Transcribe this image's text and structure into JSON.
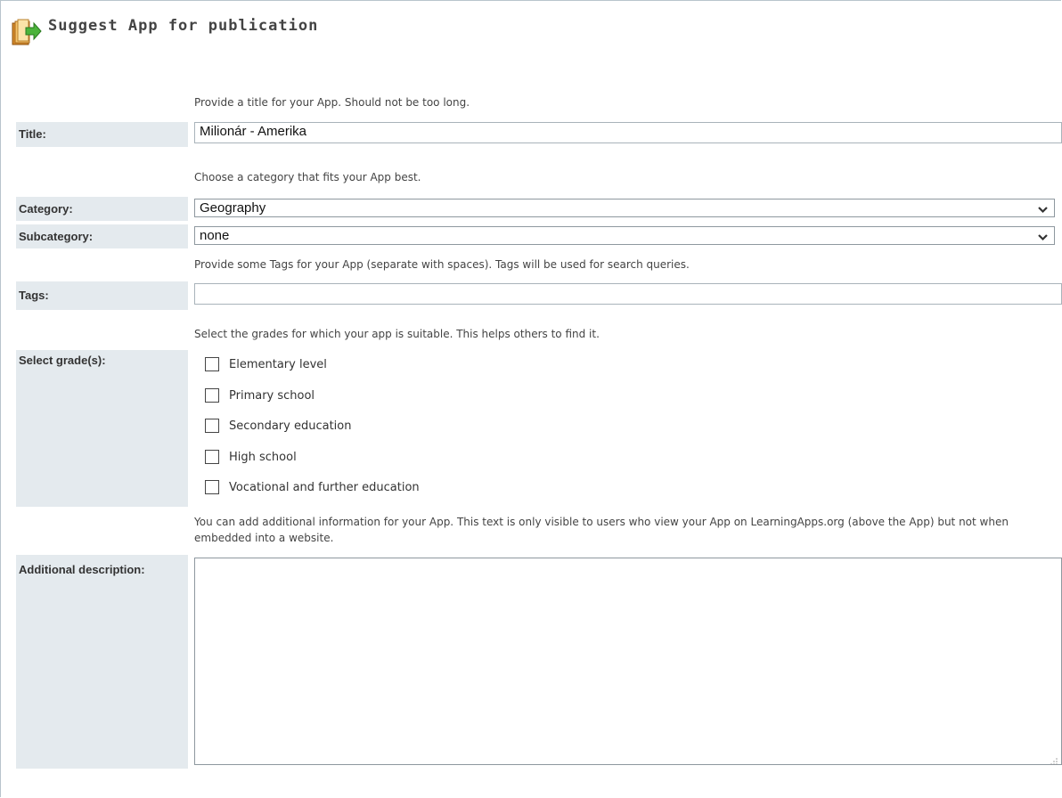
{
  "header": {
    "title": "Suggest App for publication",
    "icon": "book-arrow-icon"
  },
  "title_section": {
    "hint": "Provide a title for your App. Should not be too long.",
    "label": "Title:",
    "value": "Milionár - Amerika"
  },
  "category_section": {
    "hint": "Choose a category that fits your App best.",
    "label": "Category:",
    "value": "Geography",
    "sub_label": "Subcategory:",
    "sub_value": "none"
  },
  "tags_section": {
    "hint": "Provide some Tags for your App (separate with spaces). Tags will be used for search queries.",
    "label": "Tags:",
    "value": ""
  },
  "grades_section": {
    "hint": "Select the grades for which your app is suitable. This helps others to find it.",
    "label": "Select grade(s):",
    "options": [
      {
        "label": "Elementary level",
        "checked": false
      },
      {
        "label": "Primary school",
        "checked": false
      },
      {
        "label": "Secondary education",
        "checked": false
      },
      {
        "label": "High school",
        "checked": false
      },
      {
        "label": "Vocational and further education",
        "checked": false
      }
    ]
  },
  "description_section": {
    "hint": "You can add additional information for your App. This text is only visible to users who view your App on LearningApps.org (above the App) but not when embedded into a website.",
    "label": "Additional description:",
    "value": ""
  },
  "colors": {
    "label_bg": "#e4eaee",
    "border": "#a9b3ba",
    "icon_green": "#3aa12e"
  }
}
